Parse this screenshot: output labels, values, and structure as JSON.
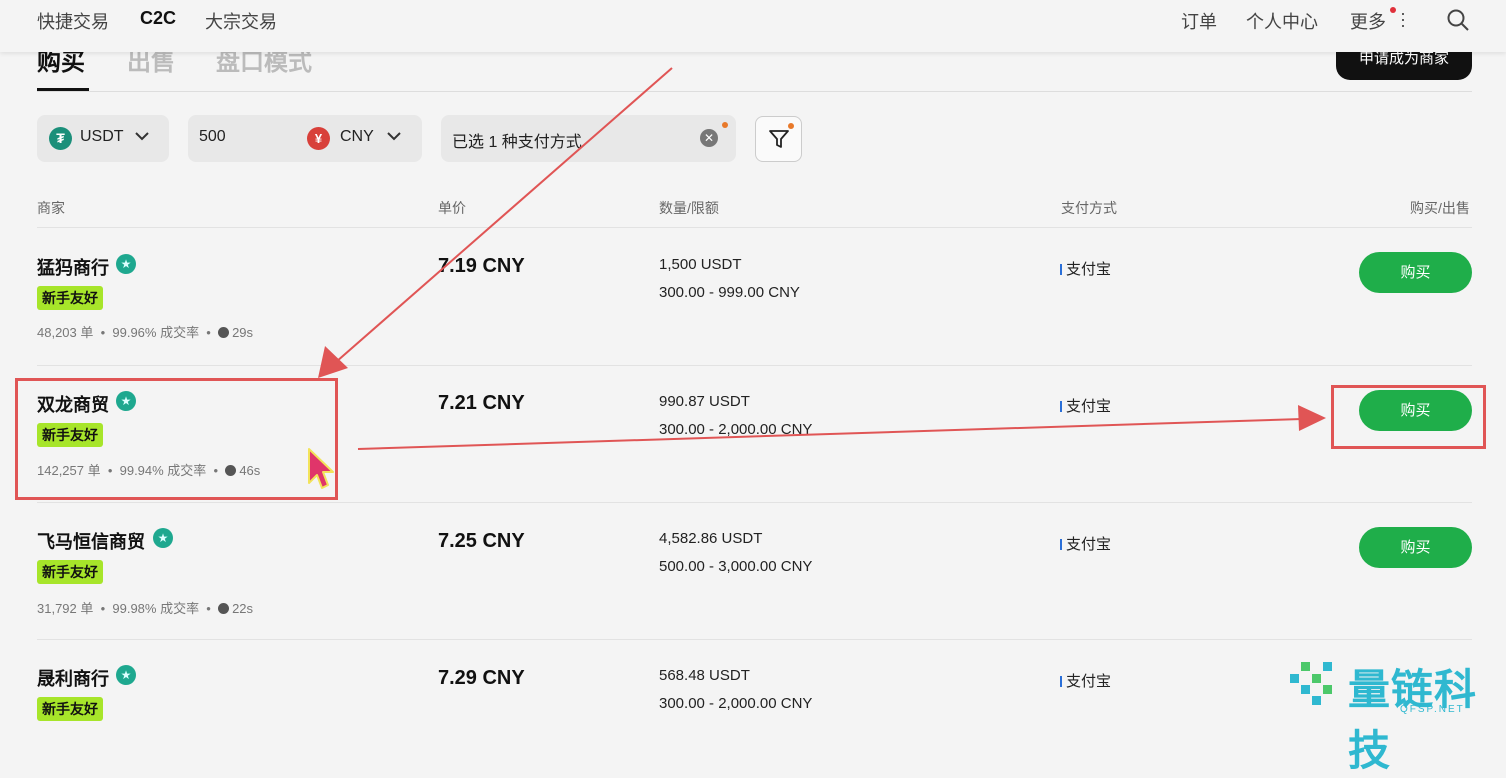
{
  "nav": {
    "left": [
      "快捷交易",
      "C2C",
      "大宗交易"
    ],
    "active": "C2C",
    "right": {
      "orders": "订单",
      "profile": "个人中心",
      "more": "更多"
    }
  },
  "tabs": {
    "buy": "购买",
    "sell": "出售",
    "book": "盘口模式"
  },
  "merchant_button": "申请成为商家",
  "filters": {
    "asset": "USDT",
    "amount": "500",
    "currency": "CNY",
    "currency_symbol": "¥",
    "payment": "已选 1 种支付方式"
  },
  "columns": {
    "merchant": "商家",
    "price": "单价",
    "quantity": "数量/限额",
    "payment": "支付方式",
    "action": "购买/出售"
  },
  "rows": [
    {
      "name": "猛犸商行",
      "badge": "新手友好",
      "orders": "48,203 单",
      "rate": "99.96% 成交率",
      "time": "29s",
      "price": "7.19 CNY",
      "qty": "1,500 USDT",
      "limit": "300.00 - 999.00 CNY",
      "pay": "支付宝",
      "action": "购买"
    },
    {
      "name": "双龙商贸",
      "badge": "新手友好",
      "orders": "142,257 单",
      "rate": "99.94% 成交率",
      "time": "46s",
      "price": "7.21 CNY",
      "qty": "990.87 USDT",
      "limit": "300.00 - 2,000.00 CNY",
      "pay": "支付宝",
      "action": "购买"
    },
    {
      "name": "飞马恒信商贸",
      "badge": "新手友好",
      "orders": "31,792 单",
      "rate": "99.98% 成交率",
      "time": "22s",
      "price": "7.25 CNY",
      "qty": "4,582.86 USDT",
      "limit": "500.00 - 3,000.00 CNY",
      "pay": "支付宝",
      "action": "购买"
    },
    {
      "name": "晟利商行",
      "badge": "新手友好",
      "price": "7.29 CNY",
      "qty": "568.48 USDT",
      "limit": "300.00 - 2,000.00 CNY",
      "pay": "支付宝"
    }
  ],
  "watermark": {
    "text": "量链科技",
    "sub": "QFSP.NET"
  },
  "colors": {
    "buy_green": "#1fae4a",
    "badge_green": "#a7e52a",
    "annotation_red": "#e05555",
    "watermark": "#2fb8d0"
  }
}
